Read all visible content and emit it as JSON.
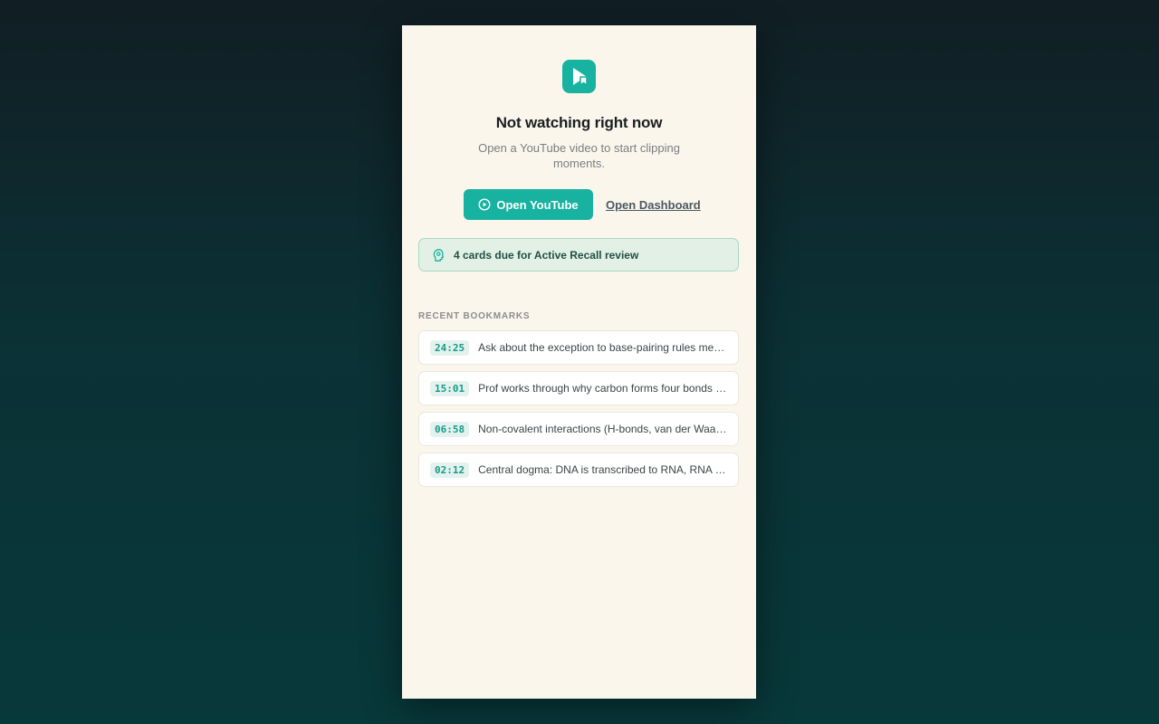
{
  "empty_state": {
    "logo_icon": "play-bookmark-icon",
    "title": "Not watching right now",
    "subtitle": "Open a YouTube video to start clipping moments."
  },
  "actions": {
    "open_youtube_label": "Open YouTube",
    "open_youtube_icon": "play-circle-icon",
    "open_dashboard_label": "Open Dashboard"
  },
  "recall": {
    "icon": "brain-icon",
    "text": "4 cards due for Active Recall review"
  },
  "recent": {
    "heading": "RECENT BOOKMARKS",
    "items": [
      {
        "time": "24:25",
        "note": "Ask about the exception to base-pairing rules mentioned in lecture"
      },
      {
        "time": "15:01",
        "note": "Prof works through why carbon forms four bonds with tetrahedral geometry"
      },
      {
        "time": "06:58",
        "note": "Non-covalent interactions (H-bonds, van der Waals, ionic) in biomolecules"
      },
      {
        "time": "02:12",
        "note": "Central dogma: DNA is transcribed to RNA, RNA is translated to protein"
      }
    ]
  },
  "colors": {
    "accent": "#17b3a0",
    "panel_background": "#faf6ec",
    "banner_background": "#e3f0e6"
  }
}
